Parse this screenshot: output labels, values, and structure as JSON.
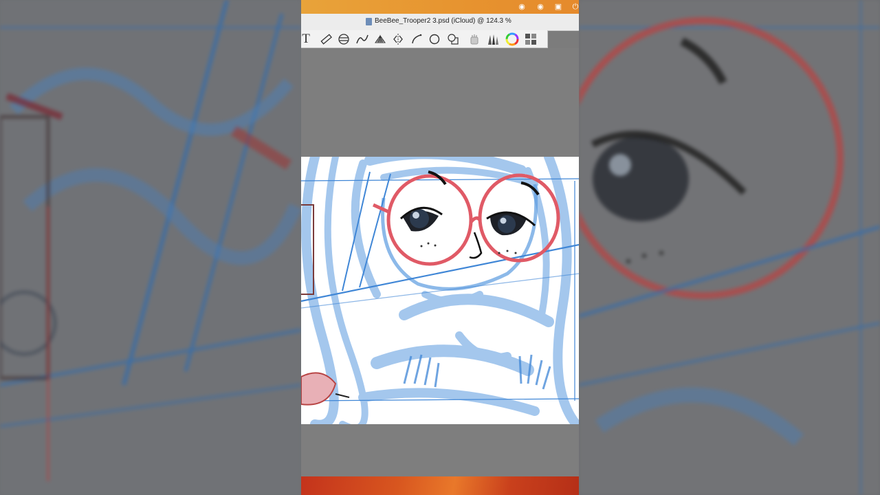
{
  "window": {
    "title": "BeeBee_Trooper2 3.psd (iCloud) @ 124.3 %"
  },
  "menubar": {
    "icons": [
      "creative-cloud-icon",
      "record-icon",
      "screen-icon",
      "power-icon"
    ]
  },
  "toolbar": {
    "text_tool_label": "T",
    "tools": [
      "text-tool-icon",
      "ruler-tool-icon",
      "ellipse-guide-icon",
      "curve-guide-icon",
      "perspective-grid-icon",
      "symmetry-icon",
      "french-curve-icon",
      "circle-guide-icon",
      "shape-icon",
      "hand-tool-icon",
      "brush-library-icon",
      "color-wheel-icon",
      "layers-grid-icon"
    ]
  },
  "colors": {
    "menubar": "#e8a33a",
    "sketch_blue": "#4a90d9",
    "glasses_red": "#e05a66",
    "canvas": "#ffffff"
  }
}
